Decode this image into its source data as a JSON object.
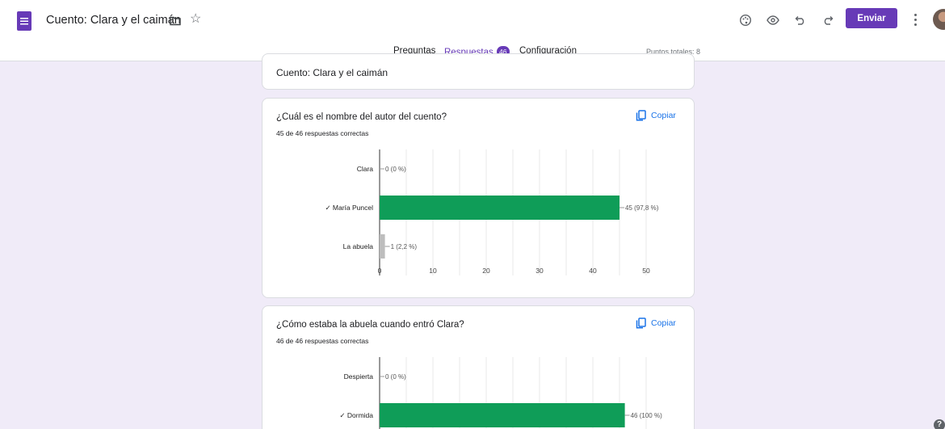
{
  "header": {
    "doc_title": "Cuento: Clara y el caimán",
    "send_label": "Enviar",
    "icons": [
      "forms-icon",
      "folder-icon",
      "star-icon",
      "palette-icon",
      "eye-icon",
      "undo-icon",
      "redo-icon",
      "more-vert-icon",
      "avatar"
    ],
    "accent": "#673ab7"
  },
  "tabs": [
    {
      "label": "Preguntas"
    },
    {
      "label": "Respuestas",
      "badge": "46",
      "active": true
    },
    {
      "label": "Configuración"
    }
  ],
  "total_points": "Puntos totales: 8",
  "title_card": {
    "title": "Cuento: Clara y el caimán"
  },
  "copy_label": "Copiar",
  "questions": [
    {
      "title": "¿Cuál es el nombre del autor del cuento?",
      "summary": "45 de 46 respuestas correctas"
    },
    {
      "title": "¿Cómo estaba la abuela cuando entró Clara?",
      "summary": "46 de 46 respuestas correctas"
    }
  ],
  "chart_data": [
    {
      "type": "bar",
      "orientation": "horizontal",
      "categories": [
        "Clara",
        "✓ María Puncel",
        "La abuela"
      ],
      "values": [
        0,
        45,
        1
      ],
      "value_labels": [
        "0 (0 %)",
        "45 (97,8 %)",
        "1 (2,2 %)"
      ],
      "xticks": [
        "0",
        "10",
        "20",
        "30",
        "40",
        "50"
      ],
      "xlim": [
        0,
        50
      ],
      "correct_color": "#0f9d58",
      "other_color": "#bdbdbd",
      "correct_index": 1
    },
    {
      "type": "bar",
      "orientation": "horizontal",
      "categories": [
        "Despierta",
        "✓ Dormida"
      ],
      "values": [
        0,
        46
      ],
      "value_labels": [
        "0 (0 %)",
        "46 (100 %)"
      ],
      "xticks": [],
      "xlim": [
        0,
        50
      ],
      "correct_color": "#0f9d58",
      "other_color": "#bdbdbd",
      "correct_index": 1
    }
  ]
}
